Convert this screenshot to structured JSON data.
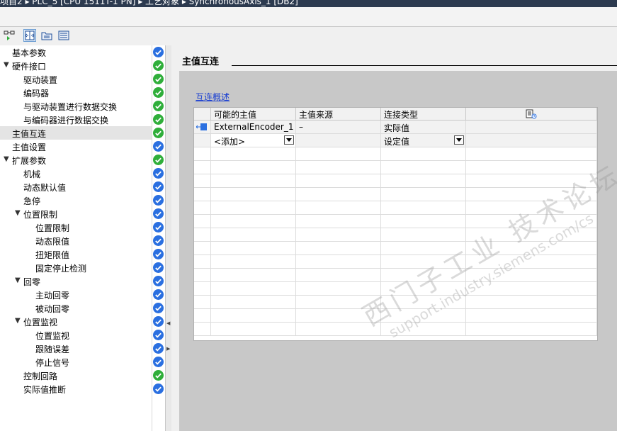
{
  "titlebar": {
    "breadcrumb": "项目2 ▸ PLC_5 [CPU 1511T-1 PN] ▸ 工艺对象 ▸ SynchronousAxis_1 [DB2]"
  },
  "nav": {
    "items": [
      {
        "label": "基本参数",
        "status": "ok-blue"
      },
      {
        "label": "硬件接口",
        "status": "ok-green",
        "expanded": true
      },
      {
        "label": "驱动装置",
        "status": "ok-green"
      },
      {
        "label": "编码器",
        "status": "ok-green"
      },
      {
        "label": "与驱动装置进行数据交换",
        "status": "ok-green"
      },
      {
        "label": "与编码器进行数据交换",
        "status": "ok-green"
      },
      {
        "label": "主值互连",
        "status": "ok-green",
        "selected": true
      },
      {
        "label": "主值设置",
        "status": "ok-blue"
      },
      {
        "label": "扩展参数",
        "status": "ok-green",
        "expanded": true
      },
      {
        "label": "机械",
        "status": "ok-blue"
      },
      {
        "label": "动态默认值",
        "status": "ok-blue"
      },
      {
        "label": "急停",
        "status": "ok-blue"
      },
      {
        "label": "位置限制",
        "status": "ok-blue",
        "expanded": true
      },
      {
        "label": "位置限制",
        "status": "ok-blue"
      },
      {
        "label": "动态限值",
        "status": "ok-blue"
      },
      {
        "label": "扭矩限值",
        "status": "ok-blue"
      },
      {
        "label": "固定停止检测",
        "status": "ok-blue"
      },
      {
        "label": "回零",
        "status": "ok-blue",
        "expanded": true
      },
      {
        "label": "主动回零",
        "status": "ok-blue"
      },
      {
        "label": "被动回零",
        "status": "ok-blue"
      },
      {
        "label": "位置监视",
        "status": "ok-blue",
        "expanded": true
      },
      {
        "label": "位置监视",
        "status": "ok-blue"
      },
      {
        "label": "跟随误差",
        "status": "ok-blue"
      },
      {
        "label": "停止信号",
        "status": "ok-blue"
      },
      {
        "label": "控制回路",
        "status": "ok-green"
      },
      {
        "label": "实际值推断",
        "status": "ok-blue"
      }
    ]
  },
  "main": {
    "section_title": "主值互连",
    "overview_link": "互连概述",
    "table": {
      "headers": [
        "可能的主值",
        "主值来源",
        "连接类型",
        ""
      ],
      "rows": [
        {
          "master": "ExternalEncoder_1",
          "source": "–",
          "type": "实际值",
          "extra": ""
        },
        {
          "master": "<添加>",
          "source": "",
          "type": "设定值",
          "extra": ""
        }
      ]
    }
  },
  "watermark": {
    "cn": "西门子工业 技术论坛",
    "url": "support.industry.siemens.com/cs"
  },
  "colors": {
    "status_green": "#2fae3a",
    "status_blue": "#2a6fe0",
    "link": "#1a3fd1"
  },
  "icons": {
    "toolbar": [
      "network-view-icon",
      "split-view-icon",
      "folder-icon",
      "list-icon"
    ],
    "header_extra": "settings-table-icon",
    "master_row": "encoder-link-icon"
  }
}
